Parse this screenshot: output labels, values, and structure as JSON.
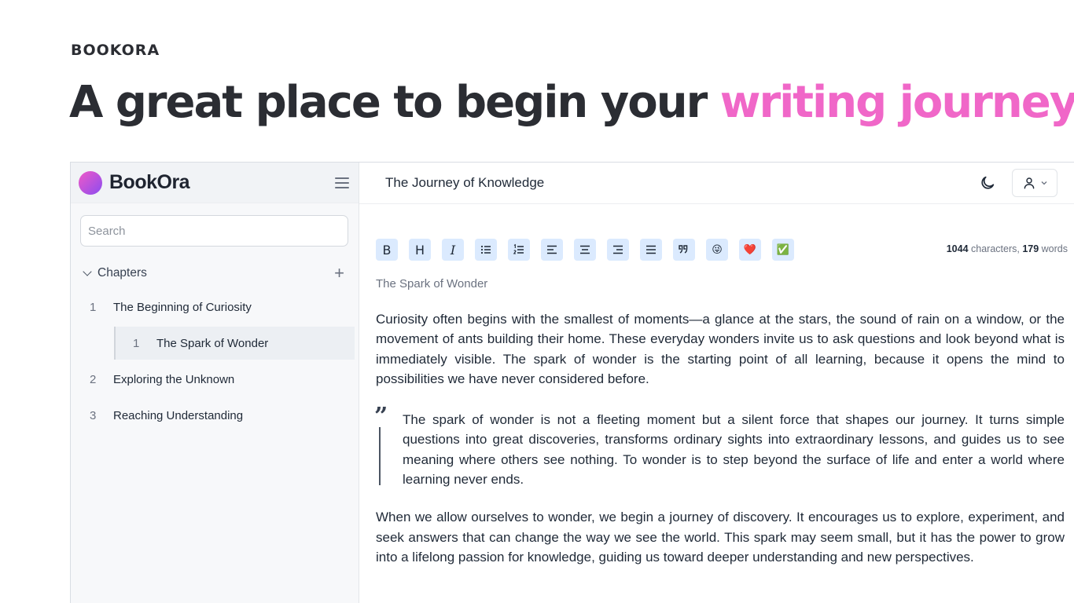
{
  "hero": {
    "brand": "BOOKORA",
    "headline_main": "A great place to begin your ",
    "headline_accent": "writing journey",
    "accent_color": "#f067c8"
  },
  "sidebar": {
    "logo_text": "BookOra",
    "menu_icon": "hamburger-menu-icon",
    "search_placeholder": "Search",
    "chapters_label": "Chapters",
    "add_icon": "plus-icon",
    "chapters": [
      {
        "num": "1",
        "label": "The Beginning of Curiosity"
      },
      {
        "num": "1",
        "label": "The Spark of Wonder",
        "sub": true,
        "selected": true
      },
      {
        "num": "2",
        "label": "Exploring the Unknown"
      },
      {
        "num": "3",
        "label": "Reaching Understanding"
      }
    ]
  },
  "topbar": {
    "doc_title": "The Journey of Knowledge",
    "theme_icon": "moon-icon",
    "user_icon": "user-icon"
  },
  "toolbar": {
    "buttons": [
      {
        "name": "bold-button",
        "glyph": "B"
      },
      {
        "name": "heading-button",
        "glyph": "H"
      },
      {
        "name": "italic-button",
        "glyph": "I"
      },
      {
        "name": "bullet-list-button",
        "glyph": "bullet-list-icon"
      },
      {
        "name": "numbered-list-button",
        "glyph": "numbered-list-icon"
      },
      {
        "name": "align-left-button",
        "glyph": "align-left-icon"
      },
      {
        "name": "align-center-button",
        "glyph": "align-center-icon"
      },
      {
        "name": "align-right-button",
        "glyph": "align-right-icon"
      },
      {
        "name": "align-justify-button",
        "glyph": "align-justify-icon"
      },
      {
        "name": "quote-button",
        "glyph": "quote-icon"
      },
      {
        "name": "emoji-smile-button",
        "glyph": "😜"
      },
      {
        "name": "emoji-heart-button",
        "glyph": "❤️"
      },
      {
        "name": "emoji-check-button",
        "glyph": "✅"
      }
    ],
    "button_bg": "#dbeafe"
  },
  "counter": {
    "characters": "1044",
    "characters_label": " characters, ",
    "words": "179",
    "words_label": " words"
  },
  "editor": {
    "subtitle": "The Spark of Wonder",
    "paragraph1": "Curiosity often begins with the smallest of moments—a glance at the stars, the sound of rain on a window, or the movement of ants building their home. These everyday wonders invite us to ask questions and look beyond what is immediately visible. The spark of wonder is the starting point of all learning, because it opens the mind to possibilities we have never considered before.",
    "quote": "The spark of wonder is not a fleeting moment but a silent force that shapes our journey. It turns simple questions into great discoveries, transforms ordinary sights into extraordinary lessons, and guides us to see meaning where others see nothing. To wonder is to step beyond the surface of life and enter a world where learning never ends.",
    "paragraph2": "When we allow ourselves to wonder, we begin a journey of discovery. It encourages us to explore, experiment, and seek answers that can change the way we see the world. This spark may seem small, but it has the power to grow into a lifelong passion for knowledge, guiding us toward deeper understanding and new perspectives."
  }
}
